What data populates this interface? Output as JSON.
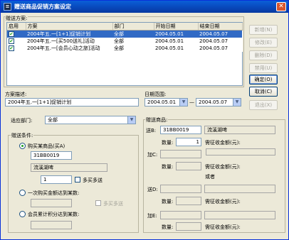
{
  "window": {
    "title": "赠送商品促销方案设定",
    "icon": "app-icon",
    "close_label": "✕"
  },
  "plans": {
    "group_label": "赠送方案:",
    "columns": [
      "启用",
      "方案",
      "部门",
      "开始日期",
      "结束日期"
    ],
    "rows": [
      {
        "enabled": "✔",
        "name": "2004年五.一[1+1]促销计划",
        "dept": "全部",
        "start": "2004.05.01",
        "end": "2004.05.07",
        "selected": true
      },
      {
        "enabled": "✔",
        "name": "2004年五.一[买500送礼]活动",
        "dept": "全部",
        "start": "2004.05.01",
        "end": "2004.05.07",
        "selected": false
      },
      {
        "enabled": "✔",
        "name": "2004年五.一[会员心动之旅]活动",
        "dept": "全部",
        "start": "2004.05.01",
        "end": "2004.05.07",
        "selected": false
      }
    ]
  },
  "buttons": {
    "add": "新增(N)",
    "edit": "修改(E)",
    "delete": "删除(D)",
    "disable": "禁用(U)",
    "ok": "确定(O)",
    "cancel": "取消(C)",
    "exit": "退出(X)"
  },
  "description": {
    "label": "方案描述:",
    "value": "2004年五.一[1+1]促销计划"
  },
  "date_range": {
    "label": "日期范围:",
    "start": "2004.05.01",
    "separator": "—",
    "end": "2004.05.07"
  },
  "department": {
    "label": "适应部门:",
    "value": "全部"
  },
  "conditions": {
    "group_label": "赠送条件:",
    "opt1_label": "购买某商品(买A)",
    "opt1_code": "31BB0019",
    "opt1_name": "流溪湖啤",
    "opt1_qty": "1",
    "opt1_multi": "多买多送",
    "opt2_label": "一次购买金额达到某数:",
    "opt2_multi": "多买多送",
    "opt3_label": "会员累计积分达到某数:"
  },
  "gifts": {
    "group_label": "赠送商品:",
    "send_label": "送B:",
    "send_code": "31BB0019",
    "send_name": "流溪湖啤",
    "qty_label": "数量:",
    "qty_value": "1",
    "amount_label": "需征收金额(元):",
    "plus_c_label": "加C:",
    "or_label": "或者",
    "send_d_label": "送D:",
    "plus_e_label": "加E:"
  }
}
